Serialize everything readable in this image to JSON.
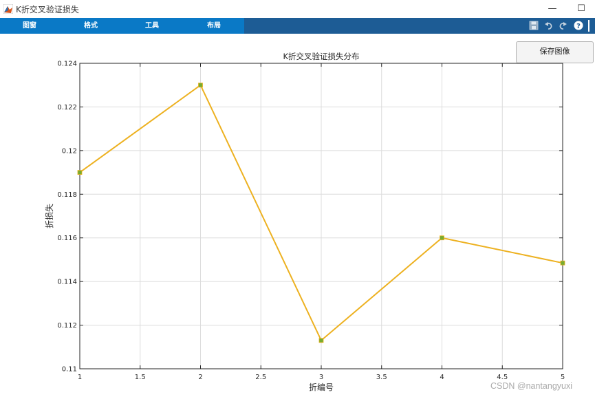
{
  "window": {
    "title": "K折交叉验证损失",
    "minimize_glyph": "—",
    "maximize_glyph": "☐"
  },
  "toolstrip": {
    "tabs": [
      {
        "label": "图窗"
      },
      {
        "label": "格式"
      },
      {
        "label": "工具"
      },
      {
        "label": "布局"
      }
    ],
    "icons": [
      "save-icon",
      "undo-icon",
      "redo-icon",
      "help-icon"
    ]
  },
  "save_button": {
    "label": "保存图像"
  },
  "chart_data": {
    "type": "line",
    "title": "K折交叉验证损失分布",
    "xlabel": "折编号",
    "ylabel": "折损失",
    "xlim": [
      1,
      5
    ],
    "ylim": [
      0.11,
      0.124
    ],
    "x_ticks": [
      "1",
      "1.5",
      "2",
      "2.5",
      "3",
      "3.5",
      "4",
      "4.5",
      "5"
    ],
    "y_ticks": [
      "0.11",
      "0.112",
      "0.114",
      "0.116",
      "0.118",
      "0.12",
      "0.122",
      "0.124"
    ],
    "grid": true,
    "series": [
      {
        "x": [
          1,
          2,
          3,
          4,
          5
        ],
        "values": [
          0.119,
          0.123,
          0.1113,
          0.116,
          0.11485
        ],
        "color": "#EDB120",
        "marker_color": "#77AC30"
      }
    ]
  },
  "watermark": "CSDN @nantangyuxi"
}
